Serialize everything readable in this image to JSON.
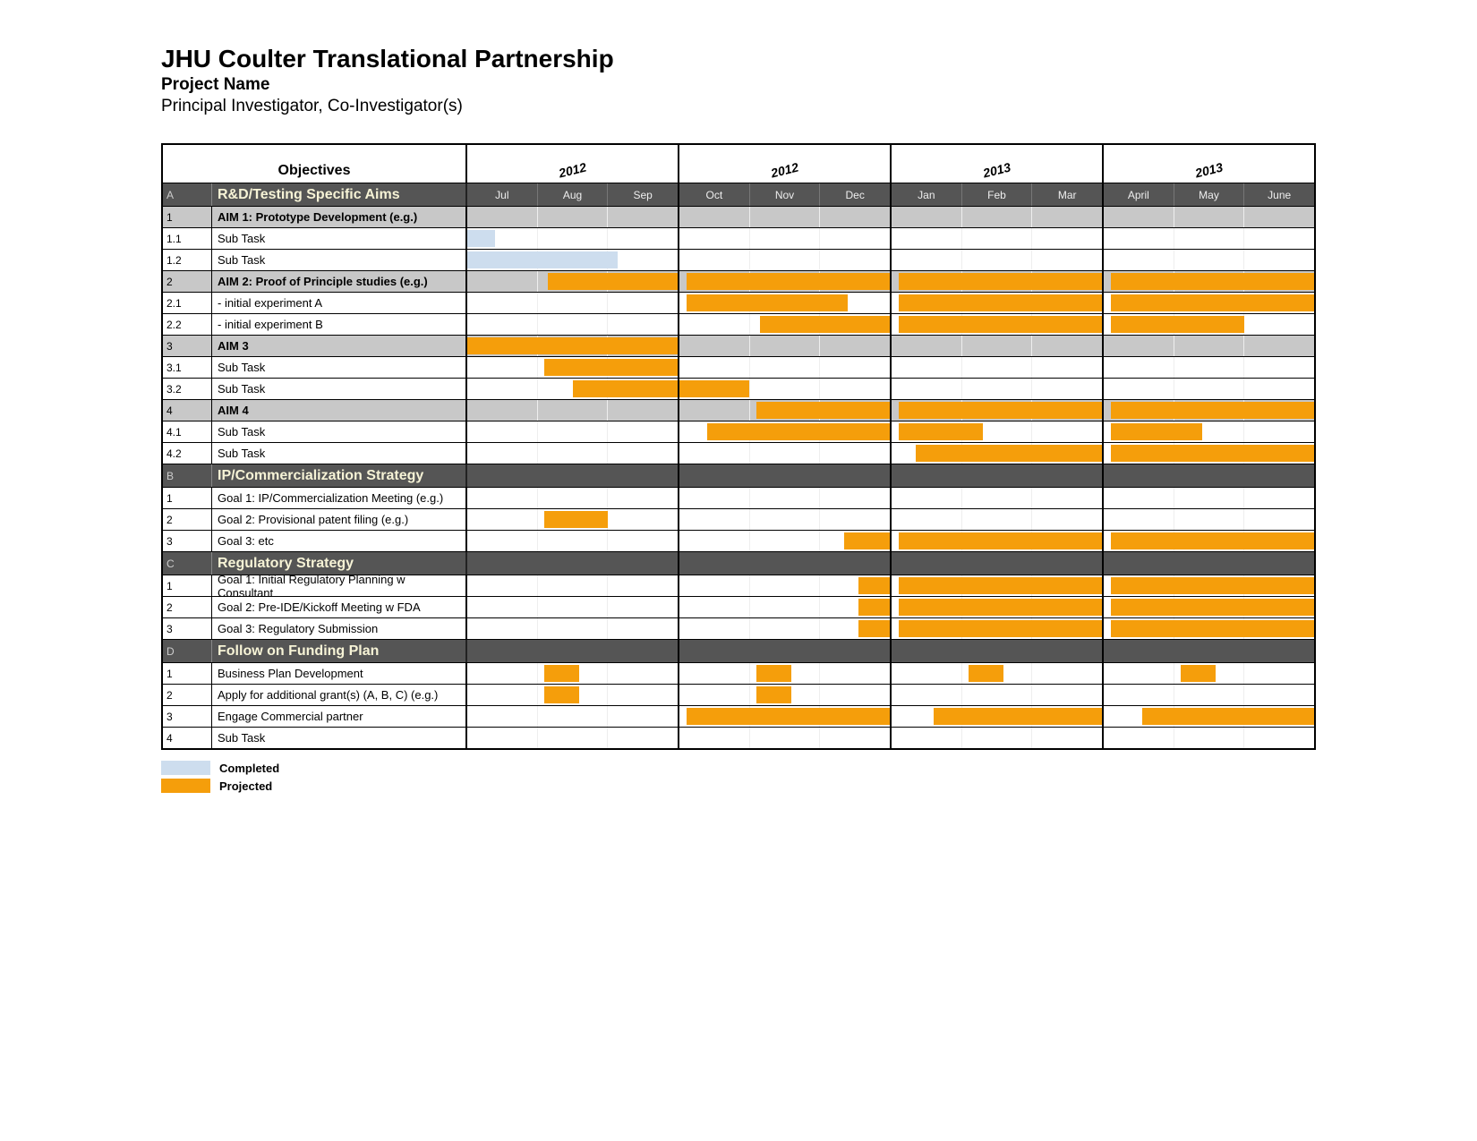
{
  "header": {
    "title": "JHU Coulter Translational Partnership",
    "subtitle": "Project Name",
    "principals": "Principal Investigator, Co-Investigator(s)"
  },
  "objectives_label": "Objectives",
  "years": [
    "2012",
    "2012",
    "2013",
    "2013"
  ],
  "months": [
    "Jul",
    "Aug",
    "Sep",
    "Oct",
    "Nov",
    "Dec",
    "Jan",
    "Feb",
    "Mar",
    "April",
    "May",
    "June"
  ],
  "legend": {
    "completed": "Completed",
    "projected": "Projected"
  },
  "colors": {
    "completed": "#cdddee",
    "projected": "#f59e0b",
    "section_bg": "#555",
    "section_fg": "#f6f3d6"
  },
  "chart_data": {
    "type": "gantt",
    "time_axis": {
      "months": [
        "Jul",
        "Aug",
        "Sep",
        "Oct",
        "Nov",
        "Dec",
        "Jan",
        "Feb",
        "Mar",
        "April",
        "May",
        "June"
      ],
      "year_groups": [
        "2012",
        "2012",
        "2013",
        "2013"
      ]
    },
    "sections": [
      {
        "id": "A",
        "label": "R&D/Testing Specific Aims",
        "groups": [
          {
            "id": "1",
            "label": "AIM 1: Prototype Development (e.g.)",
            "bars": [],
            "tasks": [
              {
                "id": "1.1",
                "label": "Sub Task",
                "bars": [
                  {
                    "start": 0.0,
                    "end": 0.4,
                    "status": "completed"
                  }
                ]
              },
              {
                "id": "1.2",
                "label": "Sub Task",
                "bars": [
                  {
                    "start": 0.0,
                    "end": 2.15,
                    "status": "completed"
                  }
                ]
              }
            ]
          },
          {
            "id": "2",
            "label": "AIM 2: Proof of Principle studies (e.g.)",
            "bars": [
              {
                "start": 1.15,
                "end": 3.0,
                "status": "projected"
              },
              {
                "start": 3.1,
                "end": 6.0,
                "status": "projected"
              },
              {
                "start": 6.1,
                "end": 9.0,
                "status": "projected"
              },
              {
                "start": 9.1,
                "end": 12.0,
                "status": "projected"
              }
            ],
            "tasks": [
              {
                "id": "2.1",
                "label": " - initial experiment A",
                "bars": [
                  {
                    "start": 3.1,
                    "end": 5.4,
                    "status": "projected"
                  },
                  {
                    "start": 6.1,
                    "end": 9.0,
                    "status": "projected"
                  },
                  {
                    "start": 9.1,
                    "end": 12.0,
                    "status": "projected"
                  }
                ]
              },
              {
                "id": "2.2",
                "label": " - initial experiment B",
                "bars": [
                  {
                    "start": 4.15,
                    "end": 6.0,
                    "status": "projected"
                  },
                  {
                    "start": 6.1,
                    "end": 9.0,
                    "status": "projected"
                  },
                  {
                    "start": 9.1,
                    "end": 11.0,
                    "status": "projected"
                  }
                ]
              }
            ]
          },
          {
            "id": "3",
            "label": "AIM 3",
            "bars": [
              {
                "start": 0.0,
                "end": 3.0,
                "status": "projected"
              }
            ],
            "tasks": [
              {
                "id": "3.1",
                "label": "Sub Task",
                "bars": [
                  {
                    "start": 1.1,
                    "end": 3.0,
                    "status": "projected"
                  }
                ]
              },
              {
                "id": "3.2",
                "label": "Sub Task",
                "bars": [
                  {
                    "start": 1.5,
                    "end": 4.0,
                    "status": "projected"
                  }
                ]
              }
            ]
          },
          {
            "id": "4",
            "label": "AIM 4",
            "bars": [
              {
                "start": 4.1,
                "end": 6.0,
                "status": "projected"
              },
              {
                "start": 6.1,
                "end": 9.0,
                "status": "projected"
              },
              {
                "start": 9.1,
                "end": 12.0,
                "status": "projected"
              }
            ],
            "tasks": [
              {
                "id": "4.1",
                "label": "Sub Task",
                "bars": [
                  {
                    "start": 3.4,
                    "end": 6.0,
                    "status": "projected"
                  },
                  {
                    "start": 6.1,
                    "end": 7.3,
                    "status": "projected"
                  },
                  {
                    "start": 9.1,
                    "end": 10.4,
                    "status": "projected"
                  }
                ]
              },
              {
                "id": "4.2",
                "label": "Sub Task",
                "bars": [
                  {
                    "start": 6.35,
                    "end": 9.0,
                    "status": "projected"
                  },
                  {
                    "start": 9.1,
                    "end": 12.0,
                    "status": "projected"
                  }
                ]
              }
            ]
          }
        ]
      },
      {
        "id": "B",
        "label": "IP/Commercialization Strategy",
        "groups": [
          {
            "id": null,
            "label": null,
            "bars": [],
            "tasks": [
              {
                "id": "1",
                "label": "Goal 1: IP/Commercialization Meeting (e.g.)",
                "bars": []
              },
              {
                "id": "2",
                "label": "Goal 2: Provisional patent filing (e.g.)",
                "bars": [
                  {
                    "start": 1.1,
                    "end": 2.0,
                    "status": "projected"
                  }
                ]
              },
              {
                "id": "3",
                "label": "Goal 3: etc",
                "bars": [
                  {
                    "start": 5.35,
                    "end": 6.0,
                    "status": "projected"
                  },
                  {
                    "start": 6.1,
                    "end": 9.0,
                    "status": "projected"
                  },
                  {
                    "start": 9.1,
                    "end": 12.0,
                    "status": "projected"
                  }
                ]
              }
            ]
          }
        ]
      },
      {
        "id": "C",
        "label": "Regulatory Strategy",
        "groups": [
          {
            "id": null,
            "label": null,
            "bars": [],
            "tasks": [
              {
                "id": "1",
                "label": "Goal 1: Initial Regulatory Planning w Consultant",
                "bars": [
                  {
                    "start": 5.55,
                    "end": 6.0,
                    "status": "projected"
                  },
                  {
                    "start": 6.1,
                    "end": 9.0,
                    "status": "projected"
                  },
                  {
                    "start": 9.1,
                    "end": 12.0,
                    "status": "projected"
                  }
                ]
              },
              {
                "id": "2",
                "label": "Goal 2: Pre-IDE/Kickoff Meeting w FDA",
                "bars": [
                  {
                    "start": 5.55,
                    "end": 6.0,
                    "status": "projected"
                  },
                  {
                    "start": 6.1,
                    "end": 9.0,
                    "status": "projected"
                  },
                  {
                    "start": 9.1,
                    "end": 12.0,
                    "status": "projected"
                  }
                ]
              },
              {
                "id": "3",
                "label": "Goal 3: Regulatory Submission",
                "bars": [
                  {
                    "start": 5.55,
                    "end": 6.0,
                    "status": "projected"
                  },
                  {
                    "start": 6.1,
                    "end": 9.0,
                    "status": "projected"
                  },
                  {
                    "start": 9.1,
                    "end": 12.0,
                    "status": "projected"
                  }
                ]
              }
            ]
          }
        ]
      },
      {
        "id": "D",
        "label": "Follow on Funding Plan",
        "groups": [
          {
            "id": null,
            "label": null,
            "bars": [],
            "tasks": [
              {
                "id": "1",
                "label": "Business Plan Development",
                "bars": [
                  {
                    "start": 1.1,
                    "end": 1.6,
                    "status": "projected"
                  },
                  {
                    "start": 4.1,
                    "end": 4.6,
                    "status": "projected"
                  },
                  {
                    "start": 7.1,
                    "end": 7.6,
                    "status": "projected"
                  },
                  {
                    "start": 10.1,
                    "end": 10.6,
                    "status": "projected"
                  }
                ]
              },
              {
                "id": "2",
                "label": "Apply for additional grant(s) (A, B, C) (e.g.)",
                "bars": [
                  {
                    "start": 1.1,
                    "end": 1.6,
                    "status": "projected"
                  },
                  {
                    "start": 4.1,
                    "end": 4.6,
                    "status": "projected"
                  }
                ]
              },
              {
                "id": "3",
                "label": "Engage Commercial partner",
                "bars": [
                  {
                    "start": 3.1,
                    "end": 6.0,
                    "status": "projected"
                  },
                  {
                    "start": 6.6,
                    "end": 9.0,
                    "status": "projected"
                  },
                  {
                    "start": 9.55,
                    "end": 12.0,
                    "status": "projected"
                  }
                ]
              },
              {
                "id": "4",
                "label": "Sub Task",
                "bars": []
              }
            ]
          }
        ]
      }
    ]
  }
}
